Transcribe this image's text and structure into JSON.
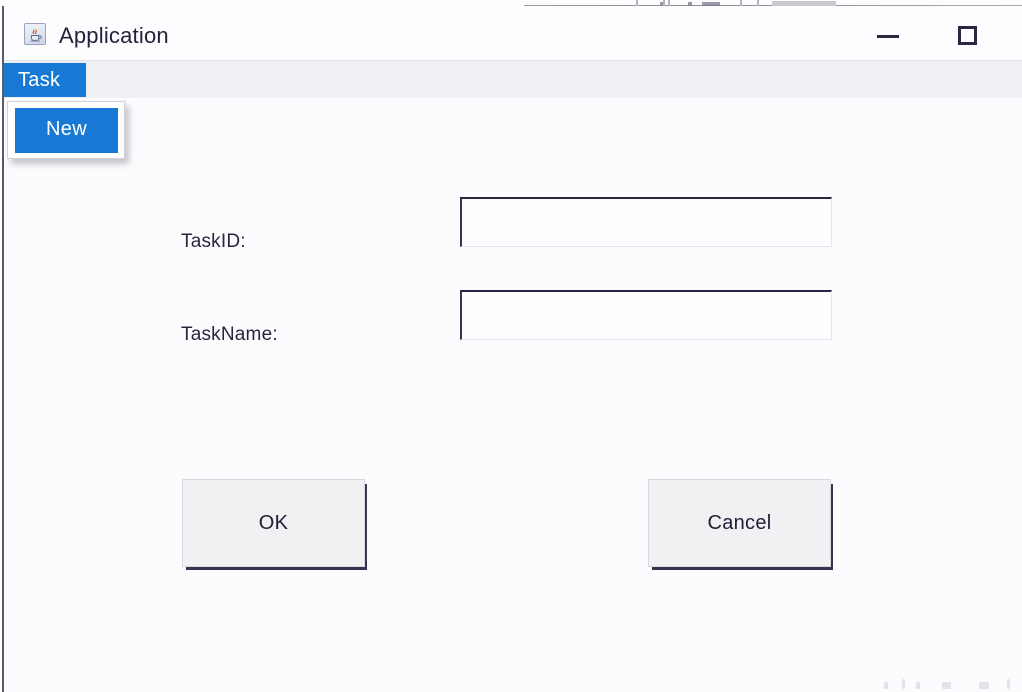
{
  "window": {
    "title": "Application",
    "icon": "java-coffee-cup-icon",
    "controls": {
      "minimize_label": "—",
      "minimize_icon": "minimize-icon",
      "maximize_label": "☐",
      "maximize_icon": "maximize-icon"
    }
  },
  "menubar": {
    "items": [
      {
        "label": "Task",
        "selected": true
      }
    ],
    "highlight_color": "#1779d3"
  },
  "dropdown": {
    "open": true,
    "parent": "Task",
    "items": [
      {
        "label": "New",
        "highlighted": true
      }
    ]
  },
  "form": {
    "fields": [
      {
        "label": "TaskID:",
        "value": "",
        "placeholder": ""
      },
      {
        "label": "TaskName:",
        "value": "",
        "placeholder": ""
      }
    ],
    "buttons": {
      "ok_label": "OK",
      "cancel_label": "Cancel"
    }
  },
  "colors": {
    "accent_blue": "#1779d3",
    "menubar_bg": "#eef0f4",
    "window_bg": "#fcfcfe",
    "button_bg": "#f1f1f4",
    "text": "#25213a"
  }
}
